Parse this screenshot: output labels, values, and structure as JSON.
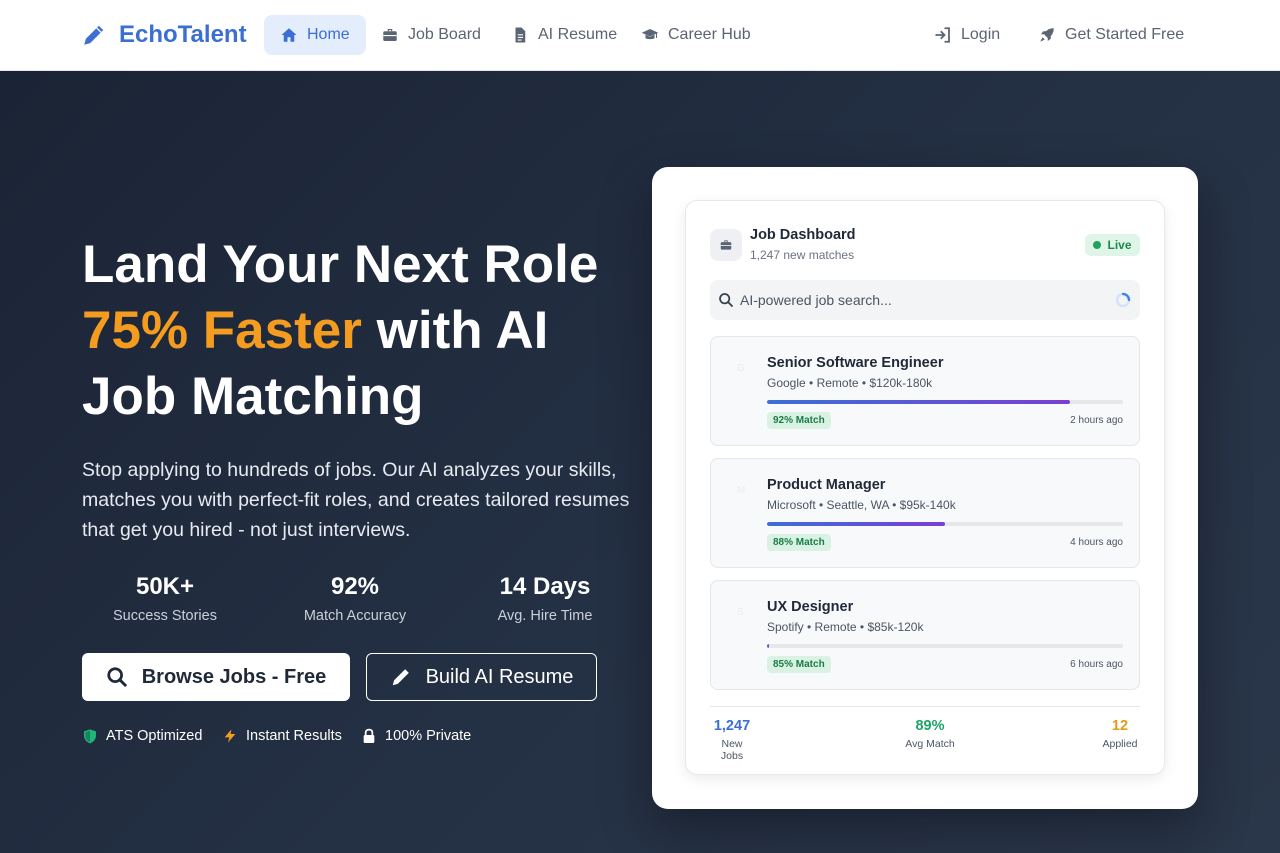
{
  "brand": {
    "name": "EchoTalent"
  },
  "nav": {
    "items": [
      {
        "label": "Home",
        "icon": "home-icon",
        "active": true
      },
      {
        "label": "Job Board",
        "icon": "briefcase-icon",
        "active": false
      },
      {
        "label": "AI Resume",
        "icon": "document-icon",
        "active": false
      },
      {
        "label": "Career Hub",
        "icon": "graduation-cap-icon",
        "active": false
      }
    ],
    "login": "Login",
    "get_started": "Get Started Free"
  },
  "hero": {
    "headline_line1": "Land Your Next Role",
    "headline_accent": "75% Faster",
    "headline_line2_rest": " with AI",
    "headline_line3": "Job Matching",
    "subtitle": "Stop applying to hundreds of jobs. Our AI analyzes your skills, matches you with perfect-fit roles, and creates tailored resumes that get you hired - not just interviews.",
    "stats": [
      {
        "value": "50K+",
        "label": "Success Stories"
      },
      {
        "value": "92%",
        "label": "Match Accuracy"
      },
      {
        "value": "14 Days",
        "label": "Avg. Hire Time"
      }
    ],
    "primary_button": "Browse Jobs - Free",
    "secondary_button": "Build AI Resume",
    "badges": [
      {
        "label": "ATS Optimized",
        "icon": "shield-icon"
      },
      {
        "label": "Instant Results",
        "icon": "lightning-icon"
      },
      {
        "label": "100% Private",
        "icon": "lock-icon"
      }
    ]
  },
  "dashboard": {
    "title": "Job Dashboard",
    "subtitle": "1,247 new matches",
    "status": "Live",
    "search_placeholder": "AI-powered job search...",
    "jobs": [
      {
        "logo": "G",
        "title": "Senior Software Engineer",
        "meta": "Google • Remote • $120k-180k",
        "progress": 0.85,
        "match": "92% Match",
        "time": "2 hours ago"
      },
      {
        "logo": "M",
        "title": "Product Manager",
        "meta": "Microsoft • Seattle, WA • $95k-140k",
        "progress": 0.5,
        "match": "88% Match",
        "time": "4 hours ago"
      },
      {
        "logo": "S",
        "title": "UX Designer",
        "meta": "Spotify • Remote • $85k-120k",
        "progress": 0.005,
        "match": "85% Match",
        "time": "6 hours ago"
      }
    ],
    "footer_stats": [
      {
        "value": "1,247",
        "label": "New Jobs",
        "color": "#3b6fd4"
      },
      {
        "value": "89%",
        "label": "Avg Match",
        "color": "#1fa36b"
      },
      {
        "value": "12",
        "label": "Applied",
        "color": "#e59a12"
      }
    ]
  },
  "colors": {
    "accent": "#f39c1f",
    "brand": "#3b6fd4",
    "live": "#1fa35a"
  }
}
